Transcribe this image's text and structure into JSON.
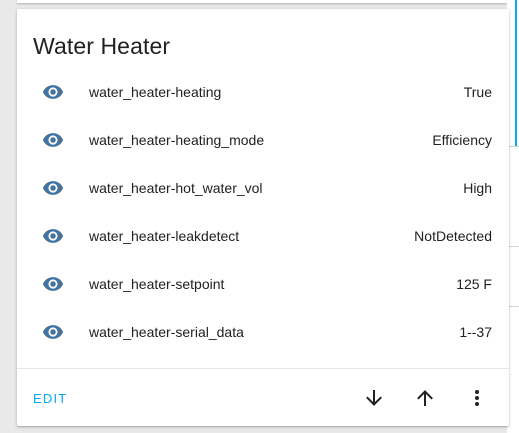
{
  "card": {
    "title": "Water Heater",
    "entities": [
      {
        "name": "water_heater-heating",
        "value": "True",
        "icon": "eye-icon"
      },
      {
        "name": "water_heater-heating_mode",
        "value": "Efficiency",
        "icon": "eye-icon"
      },
      {
        "name": "water_heater-hot_water_vol",
        "value": "High",
        "icon": "eye-icon"
      },
      {
        "name": "water_heater-leakdetect",
        "value": "NotDetected",
        "icon": "eye-icon"
      },
      {
        "name": "water_heater-setpoint",
        "value": "125 F",
        "icon": "eye-icon"
      },
      {
        "name": "water_heater-serial_data",
        "value": "1--37",
        "icon": "eye-icon"
      }
    ],
    "actions": {
      "edit_label": "EDIT",
      "move_down_icon": "arrow-down-icon",
      "move_up_icon": "arrow-up-icon",
      "menu_icon": "more-vertical-icon"
    }
  },
  "colors": {
    "accent": "#03a9f4",
    "icon": "#44739e",
    "text": "#212121"
  }
}
